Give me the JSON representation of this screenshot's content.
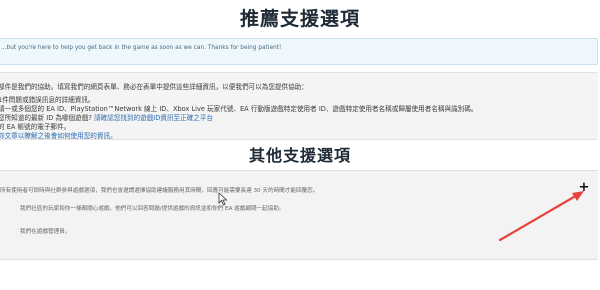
{
  "page": {
    "title": "推薦支援選項",
    "subtitle": "其他支援選項"
  },
  "notice": {
    "text": "...but you're here to help you get back in the game as soon as we can. Thanks for being patient!"
  },
  "info": {
    "lines": [
      "部件是我們的協助。填寫我們的網頁表單、務必在表單中提供這些詳細資訊，以便我們可以為您提供協助：",
      "1件問題或錯誤訊息的詳細資訊。",
      "請一或多個您的 EA ID、PlayStation™Network 線上 ID、Xbox Live 玩家代號、EA 行動版遊戲特定使用者 ID、遊戲特定使用者名稱或歸屬使用者名稱與識別碼。",
      "您所知道的最新 ID 為哪個遊戲?"
    ],
    "line5_text": "的 EA 帳號的電子郵件。",
    "link_inline": "請確認您找到的遊戲ID資訊至正確之平台",
    "link_line": "你文章以瞭解之後會如何使用您的資訊。"
  },
  "options": {
    "lines": [
      "所有使用者可即時與社群參與遊戲選項，我們也會邀請選擇協助建議服務用其時間，回應可能需要長達 30 天的時間才能回覆您。",
      "我們社區的玩家和你一樣都關心遊戲，他們可以回答問題/提供遊戲的資訊並和你們 EA 遊戲顧問一起協助。",
      "我們在遊戲管理員。"
    ],
    "expand_label": "+"
  },
  "colors": {
    "notice_bg": "#eef7fc",
    "panel_bg": "#f4f4f4",
    "annotation_arrow": "#e8413c",
    "link": "#2f6db3"
  }
}
